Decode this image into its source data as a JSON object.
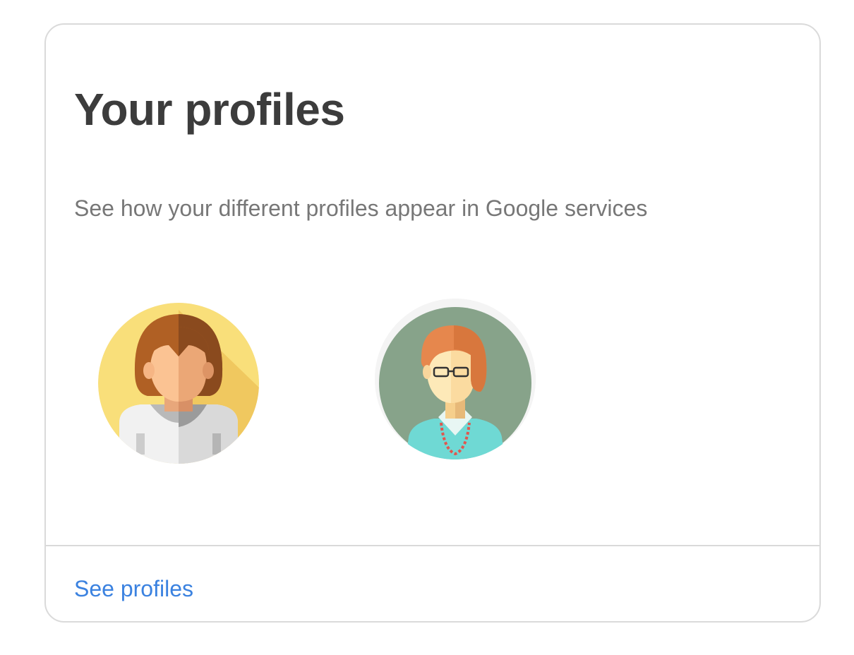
{
  "card": {
    "title": "Your profiles",
    "subtitle": "See how your different profiles appear in Google services",
    "link_label": "See profiles",
    "avatars": [
      {
        "icon": "woman-brown-hair-avatar-icon",
        "background": "#f9de79"
      },
      {
        "icon": "woman-red-hair-glasses-avatar-icon",
        "background": "#86a38a"
      }
    ]
  },
  "colors": {
    "title": "#3c3c3c",
    "subtitle": "#777777",
    "link": "#3b82e0",
    "border": "#dadada"
  }
}
